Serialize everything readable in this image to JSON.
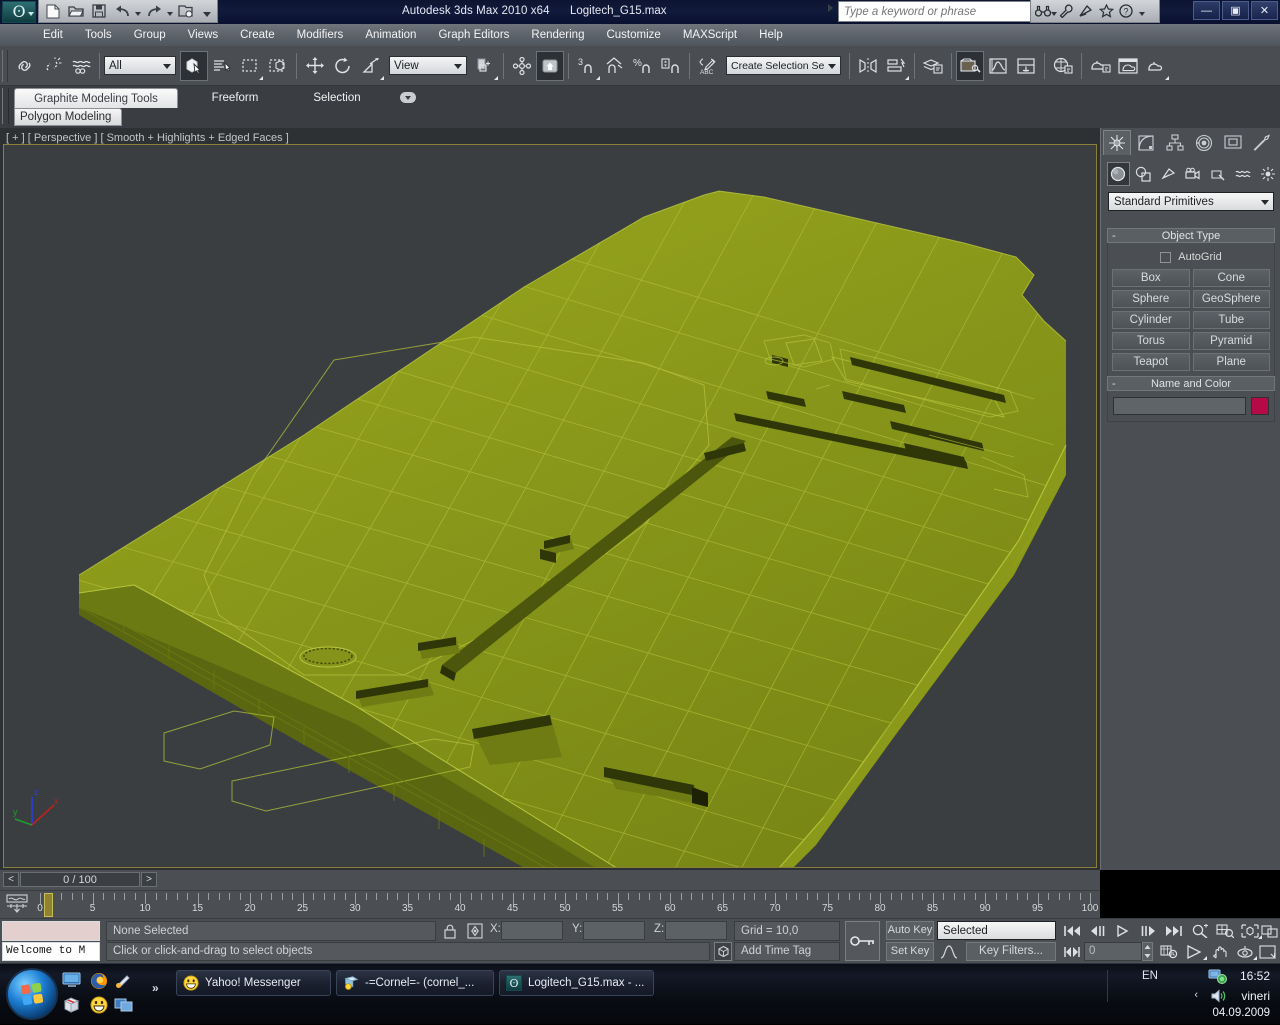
{
  "titlebar": {
    "app_title": "Autodesk 3ds Max  2010 x64",
    "file_title": "Logitech_G15.max",
    "search_placeholder": "Type a keyword or phrase",
    "quick_access": [
      {
        "name": "new-file-icon",
        "glyph": "⬜"
      },
      {
        "name": "open-file-icon",
        "glyph": "📂"
      },
      {
        "name": "save-file-icon",
        "glyph": "💾"
      },
      {
        "name": "undo-icon",
        "glyph": "↩"
      },
      {
        "name": "redo-icon",
        "glyph": "↪"
      },
      {
        "name": "project-folder-icon",
        "glyph": "🗂"
      }
    ],
    "search_tools": [
      {
        "name": "binoculars-icon",
        "glyph": "🔭"
      },
      {
        "name": "wrench-icon",
        "glyph": "🔧"
      },
      {
        "name": "satellite-icon",
        "glyph": "📡"
      },
      {
        "name": "favorites-star-icon",
        "glyph": "☆"
      },
      {
        "name": "help-icon",
        "glyph": "?"
      }
    ],
    "window_buttons": [
      {
        "name": "minimize-button",
        "glyph": "—"
      },
      {
        "name": "restore-button",
        "glyph": "▣"
      },
      {
        "name": "close-button",
        "glyph": "✕"
      }
    ]
  },
  "menubar": {
    "items": [
      "Edit",
      "Tools",
      "Group",
      "Views",
      "Create",
      "Modifiers",
      "Animation",
      "Graph Editors",
      "Rendering",
      "Customize",
      "MAXScript",
      "Help"
    ]
  },
  "toolbar": {
    "selection_filter": "All",
    "reference_coord": "View",
    "named_selection_set": "Create Selection Se",
    "angle_snap_value": "3",
    "groups": [
      {
        "name": "select-and-link-icon"
      },
      {
        "name": "unlink-selection-icon"
      },
      {
        "name": "bind-to-space-warp-icon"
      }
    ]
  },
  "ribbon": {
    "tabs": [
      "Graphite Modeling Tools",
      "Freeform",
      "Selection"
    ],
    "active_tab": "Graphite Modeling Tools",
    "panel": "Polygon Modeling"
  },
  "viewport": {
    "label": "[ + ] [ Perspective ] [ Smooth + Highlights + Edged Faces ]",
    "axis": {
      "x": "x",
      "y": "y",
      "z": "z"
    },
    "colors": {
      "background": "#3b3e40",
      "model_top": "#9aa81a",
      "model_mid": "#7e8f14",
      "model_side": "#6e7d12",
      "wire": "#b9c63c",
      "border": "#8c7f3a"
    }
  },
  "command_panel": {
    "tabs": [
      {
        "name": "create-tab",
        "glyph": "create"
      },
      {
        "name": "modify-tab",
        "glyph": "modify"
      },
      {
        "name": "hierarchy-tab",
        "glyph": "hierarchy"
      },
      {
        "name": "motion-tab",
        "glyph": "motion"
      },
      {
        "name": "display-tab",
        "glyph": "display"
      },
      {
        "name": "utilities-tab",
        "glyph": "utilities"
      }
    ],
    "subtabs": [
      {
        "name": "geometry-button"
      },
      {
        "name": "shapes-button"
      },
      {
        "name": "lights-button"
      },
      {
        "name": "cameras-button"
      },
      {
        "name": "helpers-button"
      },
      {
        "name": "space-warps-button"
      },
      {
        "name": "systems-button"
      }
    ],
    "category": "Standard Primitives",
    "object_type": {
      "title": "Object Type",
      "autogrid_label": "AutoGrid",
      "autogrid_checked": false,
      "buttons": [
        "Box",
        "Cone",
        "Sphere",
        "GeoSphere",
        "Cylinder",
        "Tube",
        "Torus",
        "Pyramid",
        "Teapot",
        "Plane"
      ]
    },
    "name_and_color": {
      "title": "Name and Color",
      "name_value": "",
      "color": "#b50a46"
    }
  },
  "trackbar": {
    "prev_label": "<",
    "next_label": ">",
    "frame_label": "0 / 100"
  },
  "timeline": {
    "ticks": [
      0,
      5,
      10,
      15,
      20,
      25,
      30,
      35,
      40,
      45,
      50,
      55,
      60,
      65,
      70,
      75,
      80,
      85,
      90,
      95,
      100
    ],
    "min": 0,
    "max": 100,
    "current": 0
  },
  "status": {
    "maxscript_prompt": "Welcome to M",
    "selection_text": "None Selected",
    "prompt_text": "Click or click-and-drag to select objects",
    "coords": [
      {
        "label": "X:",
        "value": ""
      },
      {
        "label": "Y:",
        "value": ""
      },
      {
        "label": "Z:",
        "value": ""
      }
    ],
    "grid_text": "Grid = 10,0",
    "add_time_tag": "Add Time Tag",
    "auto_key": "Auto Key",
    "set_key": "Set Key",
    "key_mode_selection": "Selected",
    "key_filters": "Key Filters...",
    "spinner_value": "0"
  },
  "taskbar": {
    "quicklaunch": [
      {
        "name": "show-desktop-icon"
      },
      {
        "name": "firefox-icon"
      },
      {
        "name": "media-icon"
      },
      {
        "name": "winrar-icon"
      },
      {
        "name": "yahoo-emoticon-icon"
      },
      {
        "name": "switch-window-icon"
      }
    ],
    "overflow_glyph": "»",
    "tasks": [
      {
        "name": "taskbar-item-yahoo",
        "label": "Yahoo! Messenger",
        "icon": "smiley"
      },
      {
        "name": "taskbar-item-cornel",
        "label": "-=Cornel=- (cornel_...",
        "icon": "messenger"
      },
      {
        "name": "taskbar-item-3dsmax",
        "label": "Logitech_G15.max - ...",
        "icon": "max"
      }
    ],
    "tray": {
      "language": "EN",
      "chevron": "‹",
      "clock": "16:52",
      "user": "vineri",
      "date": "04.09.2009"
    }
  }
}
